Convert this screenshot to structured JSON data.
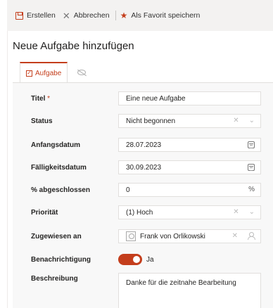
{
  "toolbar": {
    "create_label": "Erstellen",
    "cancel_label": "Abbrechen",
    "favorite_label": "Als Favorit speichern"
  },
  "page": {
    "title": "Neue Aufgabe hinzufügen"
  },
  "tabs": [
    {
      "label": "Aufgabe",
      "icon": "checkbox-icon",
      "active": true
    },
    {
      "label": "",
      "icon": "eye-off-icon",
      "active": false
    }
  ],
  "form": {
    "title": {
      "label": "Titel",
      "required_mark": "*",
      "value": "Eine neue Aufgabe"
    },
    "status": {
      "label": "Status",
      "value": "Nicht begonnen"
    },
    "start_date": {
      "label": "Anfangsdatum",
      "value": "28.07.2023"
    },
    "due_date": {
      "label": "Fälligkeitsdatum",
      "value": "30.09.2023"
    },
    "percent_complete": {
      "label": "% abgeschlossen",
      "value": "0",
      "unit": "%"
    },
    "priority": {
      "label": "Priorität",
      "value": "(1) Hoch"
    },
    "assigned_to": {
      "label": "Zugewiesen an",
      "value": "Frank von Orlikowski"
    },
    "notification": {
      "label": "Benachrichtigung",
      "value": "Ja",
      "on": true
    },
    "description": {
      "label": "Beschreibung",
      "value": "Danke für die zeitnahe Bearbeitung"
    }
  },
  "colors": {
    "accent": "#c43e1c",
    "toolbar_bg": "#f3f2f1",
    "form_bg": "#f8f8f8"
  }
}
